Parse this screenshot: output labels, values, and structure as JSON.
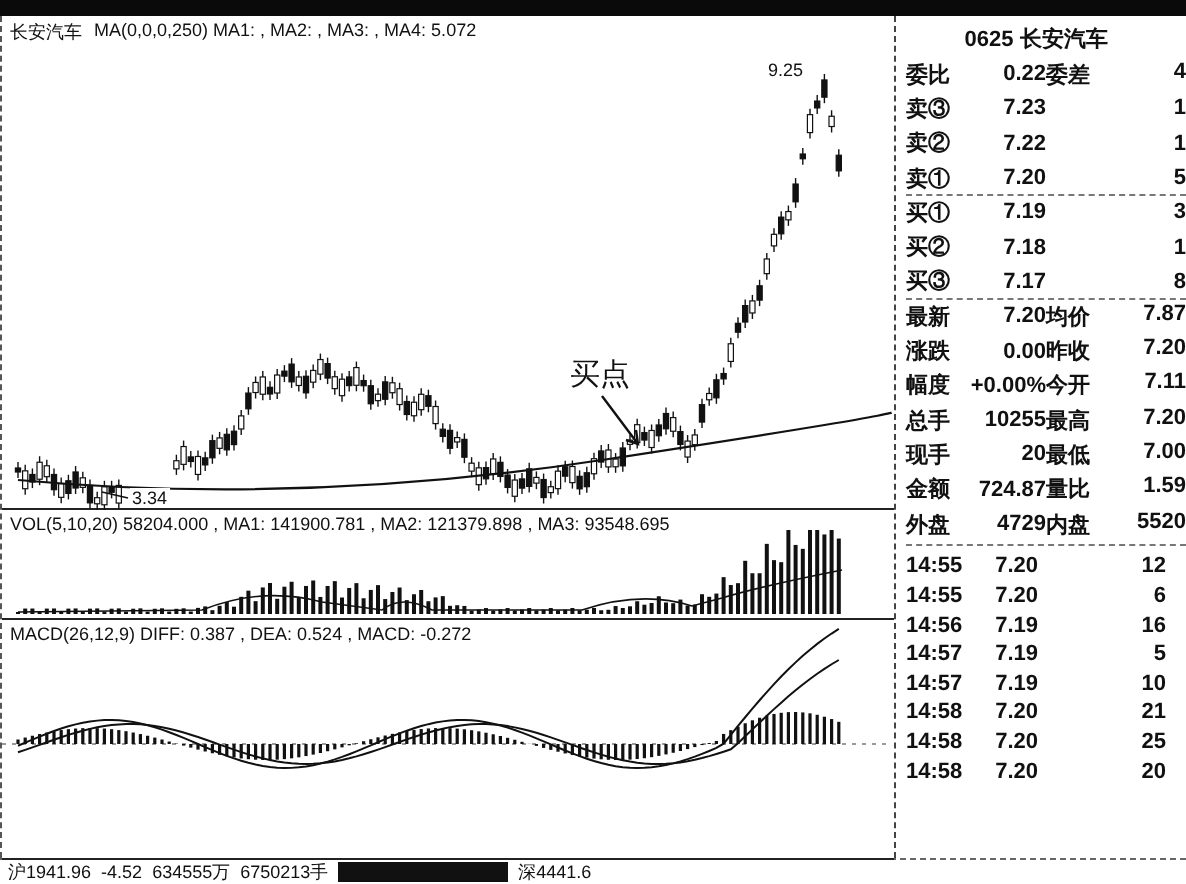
{
  "main_chart": {
    "stock_name": "长安汽车",
    "indicator": "MA(0,0,0,250)  MA1: , MA2: , MA3: , MA4: 5.072",
    "high_label": "9.25",
    "low_label": "3.34",
    "annotation": "买点"
  },
  "volume_pane": {
    "legend": "VOL(5,10,20) 58204.000 , MA1: 141900.781 , MA2: 121379.898 , MA3: 93548.695"
  },
  "macd_pane": {
    "legend": "MACD(26,12,9) DIFF: 0.387 , DEA: 0.524 , MACD: -0.272"
  },
  "quote_panel": {
    "title": "0625 长安汽车",
    "rows": [
      {
        "kind": "ratio",
        "label": "委比",
        "value": "0.22",
        "label2": "委差",
        "value2": "4"
      },
      {
        "kind": "ask",
        "label": "卖③",
        "value": "7.23",
        "value2": "1"
      },
      {
        "kind": "ask",
        "label": "卖②",
        "value": "7.22",
        "value2": "1"
      },
      {
        "kind": "ask",
        "label": "卖①",
        "value": "7.20",
        "value2": "5"
      },
      {
        "kind": "bid",
        "label": "买①",
        "value": "7.19",
        "value2": "3"
      },
      {
        "kind": "bid",
        "label": "买②",
        "value": "7.18",
        "value2": "1"
      },
      {
        "kind": "bid",
        "label": "买③",
        "value": "7.17",
        "value2": "8"
      },
      {
        "kind": "stat",
        "label": "最新",
        "value": "7.20",
        "label2": "均价",
        "value2": "7.87"
      },
      {
        "kind": "stat",
        "label": "涨跌",
        "value": "0.00",
        "label2": "昨收",
        "value2": "7.20"
      },
      {
        "kind": "stat",
        "label": "幅度",
        "value": "+0.00%",
        "label2": "今开",
        "value2": "7.11"
      },
      {
        "kind": "stat",
        "label": "总手",
        "value": "10255",
        "label2": "最高",
        "value2": "7.20"
      },
      {
        "kind": "stat",
        "label": "现手",
        "value": "20",
        "label2": "最低",
        "value2": "7.00"
      },
      {
        "kind": "stat",
        "label": "金额",
        "value": "724.87",
        "label2": "量比",
        "value2": "1.59"
      },
      {
        "kind": "stat",
        "label": "外盘",
        "value": "4729",
        "label2": "内盘",
        "value2": "5520"
      }
    ],
    "ticks": [
      {
        "time": "14:55",
        "price": "7.20",
        "volume": "12"
      },
      {
        "time": "14:55",
        "price": "7.20",
        "volume": "6"
      },
      {
        "time": "14:56",
        "price": "7.19",
        "volume": "16"
      },
      {
        "time": "14:57",
        "price": "7.19",
        "volume": "5"
      },
      {
        "time": "14:57",
        "price": "7.19",
        "volume": "10"
      },
      {
        "time": "14:58",
        "price": "7.20",
        "volume": "21"
      },
      {
        "time": "14:58",
        "price": "7.20",
        "volume": "25"
      },
      {
        "time": "14:58",
        "price": "7.20",
        "volume": "20"
      }
    ]
  },
  "status_bar": {
    "items": [
      "沪1941.96",
      "-4.52",
      "634555万",
      "6750213手"
    ],
    "trailing": "深4441.6"
  }
}
